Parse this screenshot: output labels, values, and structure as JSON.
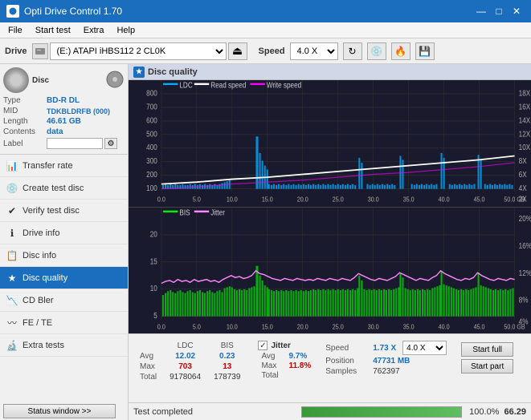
{
  "app": {
    "title": "Opti Drive Control 1.70",
    "icon": "●"
  },
  "titlebar": {
    "minimize": "—",
    "maximize": "□",
    "close": "✕"
  },
  "menu": {
    "items": [
      "File",
      "Start test",
      "Extra",
      "Help"
    ]
  },
  "toolbar": {
    "drive_label": "Drive",
    "drive_value": "(E:)  ATAPI  iHBS112   2 CL0K",
    "speed_label": "Speed",
    "speed_value": "4.0 X"
  },
  "disc": {
    "type_label": "Type",
    "type_value": "BD-R DL",
    "mid_label": "MID",
    "mid_value": "TDKBLDRFB (000)",
    "length_label": "Length",
    "length_value": "46.61 GB",
    "contents_label": "Contents",
    "contents_value": "data",
    "label_label": "Label",
    "label_value": ""
  },
  "nav": {
    "items": [
      {
        "label": "Transfer rate",
        "icon": "📊",
        "active": false
      },
      {
        "label": "Create test disc",
        "icon": "💿",
        "active": false
      },
      {
        "label": "Verify test disc",
        "icon": "✔",
        "active": false
      },
      {
        "label": "Drive info",
        "icon": "ℹ",
        "active": false
      },
      {
        "label": "Disc info",
        "icon": "📋",
        "active": false
      },
      {
        "label": "Disc quality",
        "icon": "★",
        "active": true
      },
      {
        "label": "CD Bler",
        "icon": "📉",
        "active": false
      },
      {
        "label": "FE / TE",
        "icon": "〰",
        "active": false
      },
      {
        "label": "Extra tests",
        "icon": "🔬",
        "active": false
      }
    ]
  },
  "status_btn": "Status window >>",
  "panel": {
    "title": "Disc quality"
  },
  "chart_top": {
    "legend": [
      {
        "label": "LDC",
        "color": "#00aaff"
      },
      {
        "label": "Read speed",
        "color": "#ffffff"
      },
      {
        "label": "Write speed",
        "color": "#ff00ff"
      }
    ],
    "y_max": 800,
    "y_labels": [
      "800",
      "700",
      "600",
      "500",
      "400",
      "300",
      "200",
      "100"
    ],
    "y_right_labels": [
      "18X",
      "16X",
      "14X",
      "12X",
      "10X",
      "8X",
      "6X",
      "4X",
      "2X"
    ],
    "x_labels": [
      "0.0",
      "5.0",
      "10.0",
      "15.0",
      "20.0",
      "25.0",
      "30.0",
      "35.0",
      "40.0",
      "45.0",
      "50.0 GB"
    ]
  },
  "chart_bottom": {
    "legend": [
      {
        "label": "BIS",
        "color": "#00ff00"
      },
      {
        "label": "Jitter",
        "color": "#ff66ff"
      }
    ],
    "y_max": 20,
    "y_labels": [
      "20",
      "15",
      "10",
      "5"
    ],
    "y_right_labels": [
      "20%",
      "16%",
      "12%",
      "8%",
      "4%"
    ],
    "x_labels": [
      "0.0",
      "5.0",
      "10.0",
      "15.0",
      "20.0",
      "25.0",
      "30.0",
      "35.0",
      "40.0",
      "45.0",
      "50.0 GB"
    ]
  },
  "stats": {
    "col_headers": [
      "LDC",
      "BIS"
    ],
    "avg_label": "Avg",
    "avg_ldc": "12.02",
    "avg_bis": "0.23",
    "max_label": "Max",
    "max_ldc": "703",
    "max_bis": "13",
    "total_label": "Total",
    "total_ldc": "9178064",
    "total_bis": "178739",
    "jitter_label": "Jitter",
    "jitter_avg": "9.7%",
    "jitter_max": "11.8%",
    "jitter_total": "",
    "speed_label": "Speed",
    "speed_value": "1.73 X",
    "speed_select": "4.0 X",
    "position_label": "Position",
    "position_value": "47731 MB",
    "samples_label": "Samples",
    "samples_value": "762397",
    "start_full": "Start full",
    "start_part": "Start part"
  },
  "bottom_status": {
    "text": "Test completed",
    "progress": 100.0,
    "progress_display": "100.0%",
    "speed": "66.29"
  }
}
